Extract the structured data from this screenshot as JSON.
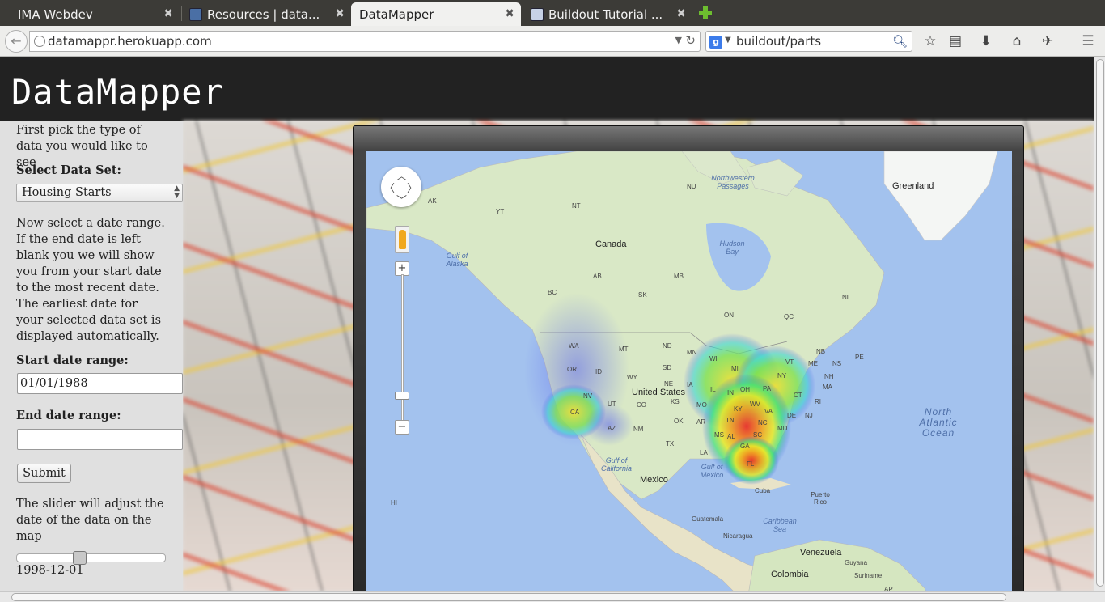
{
  "tabs": [
    {
      "title": "IMA Webdev"
    },
    {
      "title": "Resources | data..."
    },
    {
      "title": "DataMapper"
    },
    {
      "title": "Buildout Tutorial ..."
    }
  ],
  "nav": {
    "url": "datamappr.herokuapp.com",
    "search_value": "buildout/parts"
  },
  "site": {
    "title": "DataMapper"
  },
  "sidebar": {
    "intro": "First pick the type of data you would like to see",
    "select_label": "Select Data Set:",
    "select_value": "Housing Starts",
    "date_help": "Now select a date range. If the end date is left blank you we will show you from your start date to the most recent date. The earliest date for your selected data set is displayed automatically.",
    "start_label": "Start date range:",
    "start_value": "01/01/1988",
    "end_label": "End date range:",
    "end_value": "",
    "submit_label": "Submit",
    "slider_help": "The slider will adjust the date of the data on the map",
    "slider_date": "1998-12-01",
    "slider_fraction": 0.41
  },
  "map": {
    "labels": {
      "greenland": "Greenland",
      "canada": "Canada",
      "us": "United States",
      "mexico": "Mexico",
      "cuba": "Cuba",
      "venezuela": "Venezuela",
      "colombia": "Colombia",
      "guyana": "Guyana",
      "suriname": "Suriname",
      "nicaragua": "Nicaragua",
      "guatemala": "Guatemala",
      "puerto_rico": "Puerto Rico",
      "nw_passages": "Northwestern Passages",
      "hudson_bay": "Hudson Bay",
      "gulf_alaska": "Gulf of Alaska",
      "gulf_california": "Gulf of California",
      "gulf_mexico": "Gulf of Mexico",
      "caribbean": "Caribbean Sea",
      "n_atlantic": "North Atlantic Ocean"
    },
    "regions": [
      "AK",
      "YT",
      "NT",
      "NU",
      "BC",
      "AB",
      "SK",
      "MB",
      "ON",
      "QC",
      "NL",
      "NB",
      "NS",
      "PE",
      "WA",
      "OR",
      "ID",
      "MT",
      "ND",
      "MN",
      "WI",
      "MI",
      "NY",
      "VT",
      "ME",
      "NH",
      "MA",
      "CT",
      "RI",
      "NJ",
      "DE",
      "PA",
      "OH",
      "IN",
      "IL",
      "IA",
      "NE",
      "SD",
      "WY",
      "NV",
      "CA",
      "UT",
      "CO",
      "AZ",
      "NM",
      "TX",
      "OK",
      "KS",
      "MO",
      "AR",
      "LA",
      "MS",
      "AL",
      "GA",
      "FL",
      "SC",
      "NC",
      "VA",
      "WV",
      "KY",
      "TN",
      "MD",
      "HI",
      "AP"
    ]
  }
}
